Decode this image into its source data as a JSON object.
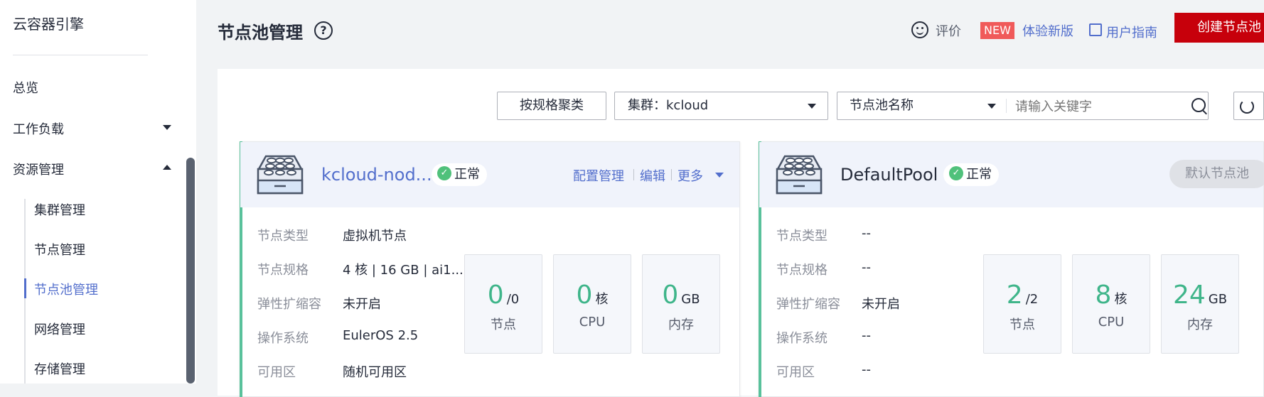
{
  "sidebar": {
    "title": "云容器引擎",
    "items": [
      {
        "label": "总览"
      },
      {
        "label": "工作负载"
      },
      {
        "label": "资源管理"
      }
    ],
    "sub_items": [
      {
        "label": "集群管理"
      },
      {
        "label": "节点管理"
      },
      {
        "label": "节点池管理"
      },
      {
        "label": "网络管理"
      },
      {
        "label": "存储管理"
      }
    ]
  },
  "header": {
    "title": "节点池管理",
    "help": "?",
    "rate_label": "评价",
    "new_badge": "NEW",
    "new_version_label": "体验新版",
    "guide_label": "用户指南",
    "create_button": "创建节点池"
  },
  "toolbar": {
    "group_button": "按规格聚类",
    "cluster_select": "集群：kcloud",
    "name_select": "节点池名称",
    "search_placeholder": "请输入关键字"
  },
  "labels": {
    "node_type": "节点类型",
    "node_spec": "节点规格",
    "autoscale": "弹性扩缩容",
    "os": "操作系统",
    "az": "可用区",
    "stat_nodes": "节点",
    "stat_cpu": "CPU",
    "stat_mem": "内存",
    "unit_core": "核",
    "unit_gb": "GB"
  },
  "pools": [
    {
      "name": "kcloud-nod...",
      "status": "正常",
      "actions": [
        "配置管理",
        "编辑",
        "更多"
      ],
      "node_type": "虚拟机节点",
      "node_spec": "4 核 | 16 GB | ai1....",
      "autoscale": "未开启",
      "os": "EulerOS 2.5",
      "az": "随机可用区",
      "nodes": "0",
      "nodes_total": "/0",
      "cpu": "0",
      "mem": "0"
    },
    {
      "name": "DefaultPool",
      "status": "正常",
      "default_badge": "默认节点池",
      "node_type": "--",
      "node_spec": "--",
      "autoscale": "未开启",
      "os": "--",
      "az": "--",
      "nodes": "2",
      "nodes_total": "/2",
      "cpu": "8",
      "mem": "24"
    }
  ],
  "colors": {
    "accent": "#526ecc",
    "brand_red": "#c7000b",
    "status_green": "#50c17b",
    "stat_green": "#3fb58a",
    "card_stripe": "#59c19b"
  }
}
